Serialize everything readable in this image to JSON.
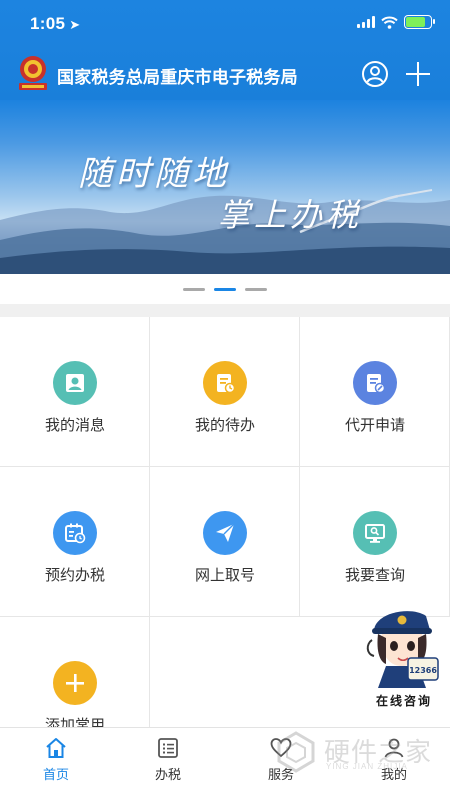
{
  "status": {
    "time": "1:05",
    "battery_color": "#7ef05a"
  },
  "header": {
    "title": "国家税务总局重庆市电子税务局",
    "user_icon": "user-circle-icon",
    "add_icon": "plus-icon",
    "background": "#1a80db"
  },
  "banner": {
    "line1": "随时随地",
    "line2": "掌上办税",
    "page_count": 3,
    "active_page": 2
  },
  "grid": [
    {
      "label": "我的消息",
      "icon": "person-icon",
      "color": "#56bfb4"
    },
    {
      "label": "我的待办",
      "icon": "todo-document-icon",
      "color": "#f3b321"
    },
    {
      "label": "代开申请",
      "icon": "invoice-edit-icon",
      "color": "#5b83e0"
    },
    {
      "label": "预约办税",
      "icon": "calendar-clock-icon",
      "color": "#3e97f0"
    },
    {
      "label": "网上取号",
      "icon": "paper-plane-icon",
      "color": "#3e97f0"
    },
    {
      "label": "我要查询",
      "icon": "monitor-search-icon",
      "color": "#56bfb4"
    },
    {
      "label": "添加常用",
      "icon": "plus-icon",
      "color": "#f3b321"
    }
  ],
  "mascot": {
    "caption": "在线咨询",
    "badge": "12366"
  },
  "tabs": [
    {
      "label": "首页",
      "icon": "home-icon",
      "active": true
    },
    {
      "label": "办税",
      "icon": "list-icon",
      "active": false
    },
    {
      "label": "服务",
      "icon": "heart-icon",
      "active": false
    },
    {
      "label": "我的",
      "icon": "person-icon",
      "active": false
    }
  ],
  "watermark": {
    "text": "硬件之家",
    "sub": "YING JIAN ZHIJIA"
  },
  "accent_color": "#1a86e5"
}
